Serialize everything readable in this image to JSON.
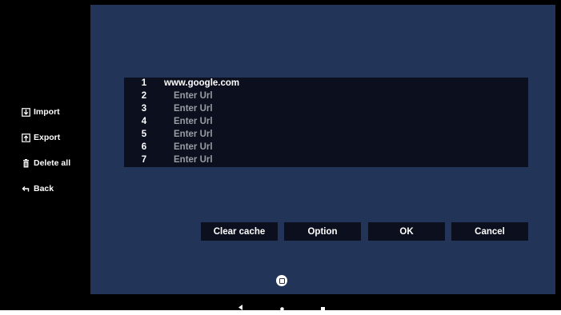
{
  "sidebar": {
    "items": [
      {
        "label": "Import",
        "icon": "import-icon"
      },
      {
        "label": "Export",
        "icon": "export-icon"
      },
      {
        "label": "Delete all",
        "icon": "trash-icon"
      },
      {
        "label": "Back",
        "icon": "back-arrow-icon"
      }
    ]
  },
  "url_list": {
    "rows": [
      {
        "num": "1",
        "value": "www.google.com",
        "placeholder": ""
      },
      {
        "num": "2",
        "value": "",
        "placeholder": "Enter Url"
      },
      {
        "num": "3",
        "value": "",
        "placeholder": "Enter Url"
      },
      {
        "num": "4",
        "value": "",
        "placeholder": "Enter Url"
      },
      {
        "num": "5",
        "value": "",
        "placeholder": "Enter Url"
      },
      {
        "num": "6",
        "value": "",
        "placeholder": "Enter Url"
      },
      {
        "num": "7",
        "value": "",
        "placeholder": "Enter Url"
      }
    ]
  },
  "buttons": {
    "clear_cache": "Clear cache",
    "option": "Option",
    "ok": "OK",
    "cancel": "Cancel"
  },
  "colors": {
    "panel": "#223457",
    "table_bg": "#0b0f1e",
    "placeholder": "#9a9da4"
  },
  "system_nav": {
    "icons": [
      "home-circle-icon",
      "nav-back-icon",
      "nav-home-icon",
      "nav-recents-icon"
    ]
  }
}
